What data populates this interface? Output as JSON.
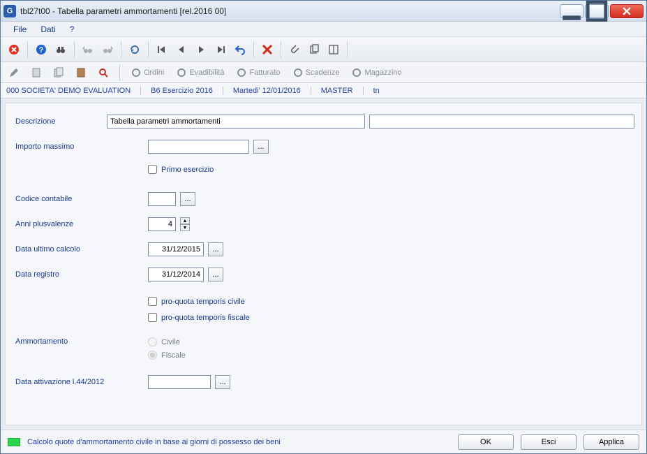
{
  "window": {
    "title": "tbl27t00 - Tabella parametri ammortamenti  [rel.2016 00]"
  },
  "menu": {
    "file": "File",
    "dati": "Dati",
    "help": "?"
  },
  "toolbar_icons": {
    "close": "close",
    "help": "help",
    "find": "binoculars",
    "find_prev": "bin-left",
    "find_next": "bin-right",
    "refresh": "refresh",
    "first": "first",
    "prev": "prev",
    "next": "next",
    "last": "last",
    "undo": "undo",
    "delete": "delete",
    "attach": "attach",
    "copy": "copy",
    "layout": "layout"
  },
  "toolbar2": {
    "edit": "edit",
    "sheet": "sheet",
    "copysheet": "copysheet",
    "book": "book",
    "zoom": "zoom",
    "ordini": "Ordini",
    "evadibilita": "Evadibilità",
    "fatturato": "Fatturato",
    "scadenze": "Scadenze",
    "magazzino": "Magazzino"
  },
  "infobar": {
    "societa": "000 SOCIETA'  DEMO EVALUATION",
    "esercizio": "B6 Esercizio 2016",
    "data": "Martedi' 12/01/2016",
    "user": "MASTER",
    "extra": "tn"
  },
  "form": {
    "descrizione_label": "Descrizione",
    "descrizione_value": "Tabella parametri ammortamenti",
    "descrizione2_value": "",
    "importo_massimo_label": "Importo massimo",
    "importo_massimo_value": "",
    "primo_esercizio_label": "Primo esercizio",
    "primo_esercizio_checked": false,
    "codice_contabile_label": "Codice contabile",
    "codice_contabile_value": "",
    "anni_plusvalenze_label": "Anni plusvalenze",
    "anni_plusvalenze_value": "4",
    "data_ultimo_calcolo_label": "Data ultimo calcolo",
    "data_ultimo_calcolo_value": "31/12/2015",
    "data_registro_label": "Data registro",
    "data_registro_value": "31/12/2014",
    "pq_civile_label": "pro-quota temporis civile",
    "pq_civile_checked": false,
    "pq_fiscale_label": "pro-quota temporis fiscale",
    "pq_fiscale_checked": false,
    "ammortamento_label": "Ammortamento",
    "ammortamento_civile_label": "Civile",
    "ammortamento_fiscale_label": "Fiscale",
    "ammortamento_selected": "Fiscale",
    "data_attivazione_label": "Data attivazione l.44/2012",
    "data_attivazione_value": ""
  },
  "status": {
    "text": "Calcolo quote d'ammortamento civile in base ai giorni di possesso dei beni"
  },
  "footer": {
    "ok": "OK",
    "esci": "Esci",
    "applica": "Applica"
  },
  "dots": "..."
}
